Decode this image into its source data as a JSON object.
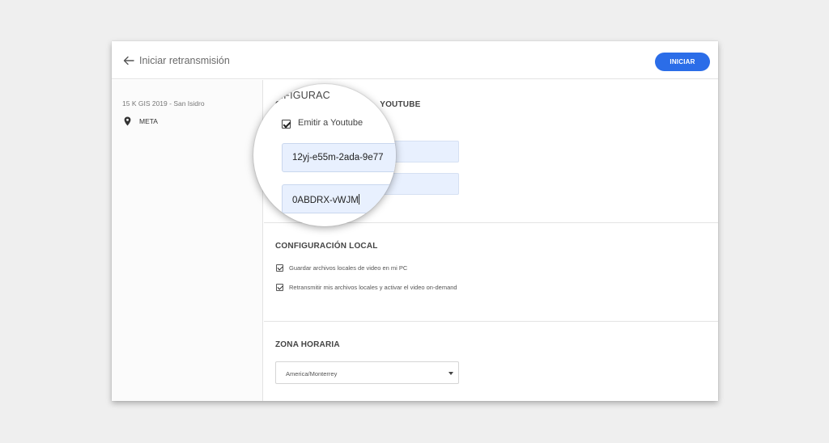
{
  "header": {
    "title": "Iniciar retransmisión",
    "start_label": "INICIAR"
  },
  "sidebar": {
    "event_name": "15 K GIS 2019 - San Isidro",
    "location": "META"
  },
  "youtube_section": {
    "title_partial_left": "CO",
    "title_partial_right": "YOUTUBE",
    "lens_title": "NFIGURAC",
    "emit_label": "Emitir a Youtube",
    "emit_checked": true,
    "stream_key": "12yj-e55m-2ada-9e77",
    "second_field_value": "0ABDRX-vWJM"
  },
  "local_section": {
    "title": "CONFIGURACIÓN LOCAL",
    "options": [
      {
        "label": "Guardar archivos locales de video en mi PC",
        "checked": true
      },
      {
        "label": "Retransmitir mis archivos locales y activar el video on-demand",
        "checked": true
      }
    ]
  },
  "timezone_section": {
    "title": "ZONA HORARIA",
    "selected": "America/Monterrey"
  },
  "colors": {
    "background": "#efefef",
    "accent": "#2b6de8",
    "field_fill": "#e8f0fe"
  },
  "icons": [
    "back-arrow-icon",
    "location-pin-icon",
    "chevron-down-icon",
    "checkbox-checked-icon"
  ]
}
